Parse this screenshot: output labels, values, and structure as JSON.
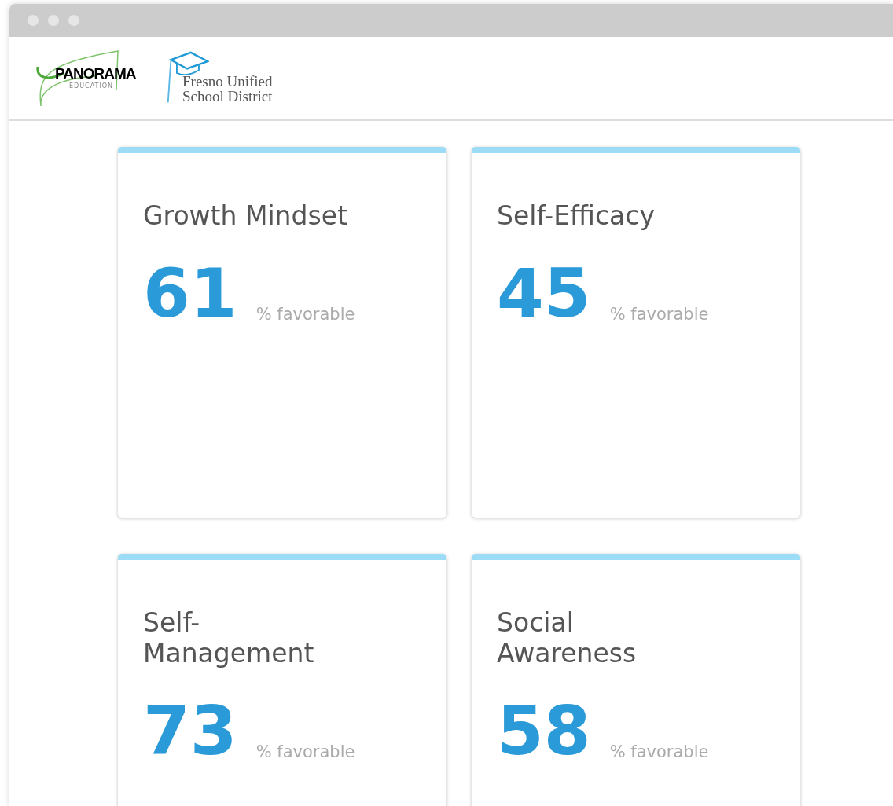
{
  "header": {
    "logos": [
      {
        "kind": "panorama",
        "name": "PANORAMA",
        "sub": "EDUCATION"
      },
      {
        "kind": "district",
        "lines": [
          "Fresno Unified",
          "School District"
        ]
      }
    ]
  },
  "cards": [
    {
      "title": "Growth Mindset",
      "value": "61",
      "unit": "% favorable"
    },
    {
      "title": "Self-Efficacy",
      "value": "45",
      "unit": "% favorable"
    },
    {
      "title": "Self-\nManagement",
      "value": "73",
      "unit": "% favorable"
    },
    {
      "title": "Social\nAwareness",
      "value": "58",
      "unit": "% favorable"
    }
  ]
}
